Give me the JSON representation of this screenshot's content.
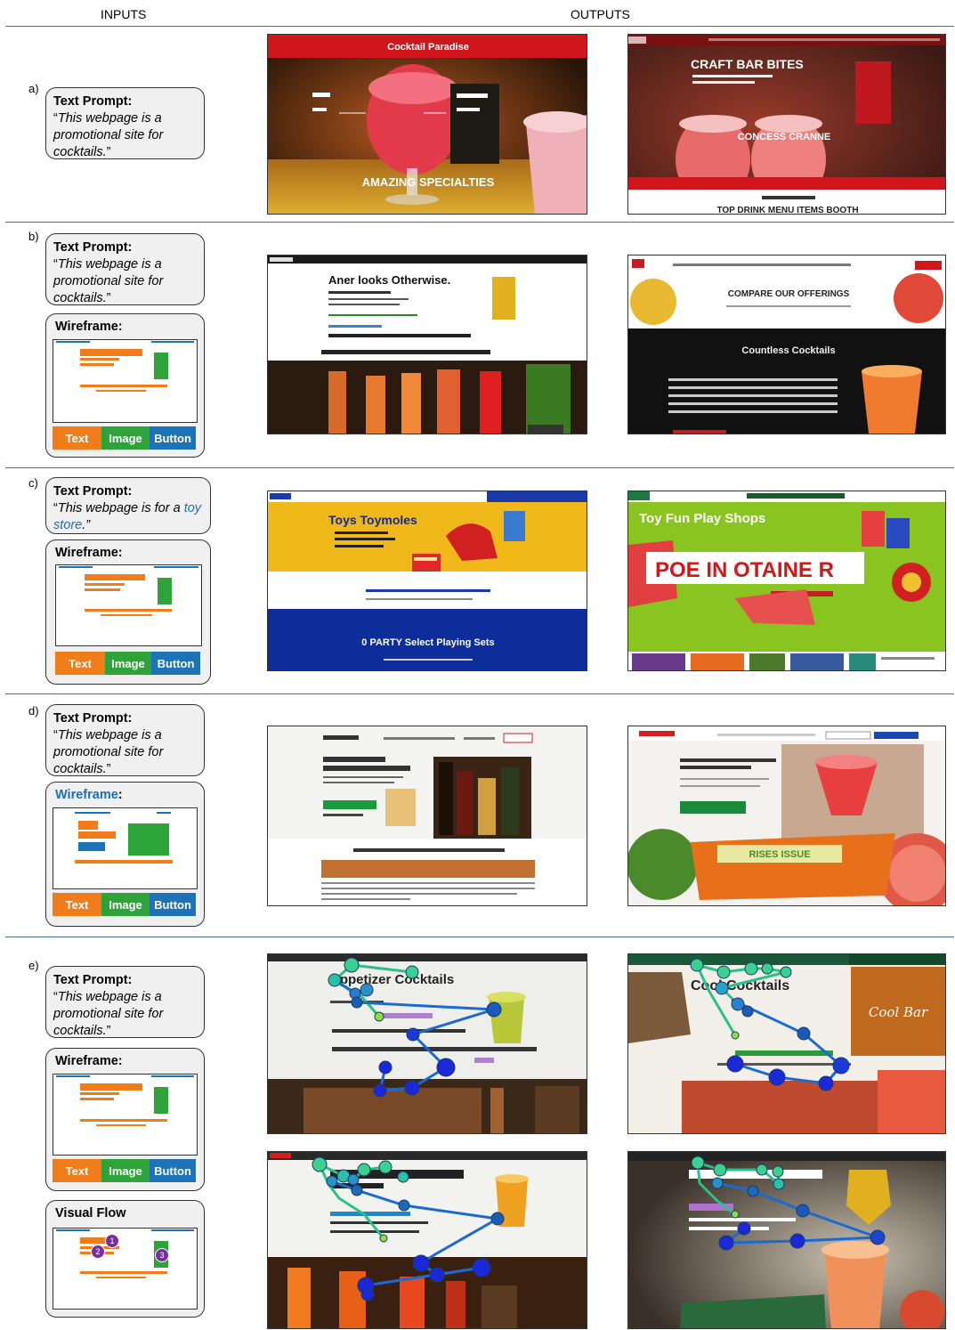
{
  "headers": {
    "inputs": "INPUTS",
    "outputs": "OUTPUTS"
  },
  "rows": [
    {
      "label": "a)",
      "prompt_title": "Text Prompt:",
      "prompt_open": "“",
      "prompt_text": "This webpage is a promotional site for cocktails.",
      "prompt_close": "”"
    },
    {
      "label": "b)",
      "prompt_title": "Text Prompt:",
      "prompt_open": "“",
      "prompt_text": "This webpage is a promotional site for cocktails.",
      "prompt_close": "”",
      "wireframe_title": "Wireframe:"
    },
    {
      "label": "c)",
      "prompt_title": "Text Prompt:",
      "prompt_open": "“",
      "prompt_text_a": "This webpage is for a ",
      "prompt_text_b": "toy store",
      "prompt_close": ".”",
      "wireframe_title": "Wireframe:"
    },
    {
      "label": "d)",
      "prompt_title": "Text Prompt:",
      "prompt_open": "“",
      "prompt_text": "This webpage is a promotional site for cocktails.",
      "prompt_close": "”",
      "wireframe_title": "Wireframe",
      "wireframe_colon": ":"
    },
    {
      "label": "e)",
      "prompt_title": "Text Prompt:",
      "prompt_open": "“",
      "prompt_text": "This webpage is a promotional site for cocktails.",
      "prompt_close": "”",
      "wireframe_title": "Wireframe:",
      "visual_flow_title": "Visual Flow",
      "flow_numbers": [
        "1",
        "2",
        "3"
      ]
    }
  ],
  "legend": {
    "text": "Text",
    "image": "Image",
    "button": "Button"
  },
  "colors": {
    "text": "#f07d1a",
    "image": "#2ea33a",
    "button": "#1c73b8",
    "flow_purple": "#7b2f9e",
    "rule": "#4a6f8a"
  },
  "outputs_text": {
    "a1_title": "Cocktail Paradise",
    "a1_bottom": "AMAZING SPECIALTIES",
    "a2_title": "CRAFT BAR BITES",
    "a2_footer": "TOP DRINK MENU ITEMS BOOTH",
    "c1_title": "Toys Toymoles",
    "c1_band": "0 PARTY Select Playing Sets",
    "c2_title": "Toy Fun Play Shops",
    "c2_banner": "POE IN OTAINE R",
    "e1_title": "Appetizer Cocktails",
    "e2_title": "Cool Cocktails",
    "e2_logo": "Cool Bar"
  }
}
